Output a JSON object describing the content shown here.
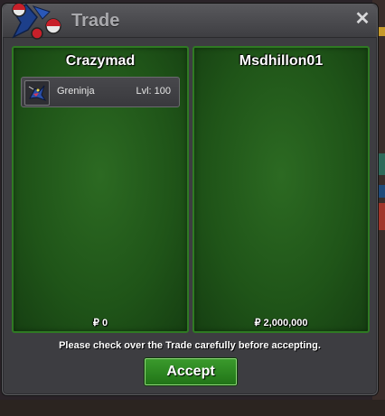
{
  "window": {
    "title": "Trade",
    "close_label": "✕"
  },
  "left_panel": {
    "player_name": "Crazymad",
    "items": [
      {
        "name": "Greninja",
        "level": "Lvl: 100",
        "icon": "greninja-icon"
      }
    ],
    "money": "₽ 0"
  },
  "right_panel": {
    "player_name": "Msdhillon01",
    "items": [],
    "money": "₽ 2,000,000"
  },
  "notice": "Please check over the Trade carefully before accepting.",
  "accept_label": "Accept",
  "colors": {
    "panel_green": "#1f5418",
    "accept_green": "#2a8420",
    "window_gray": "#3d3d41"
  }
}
